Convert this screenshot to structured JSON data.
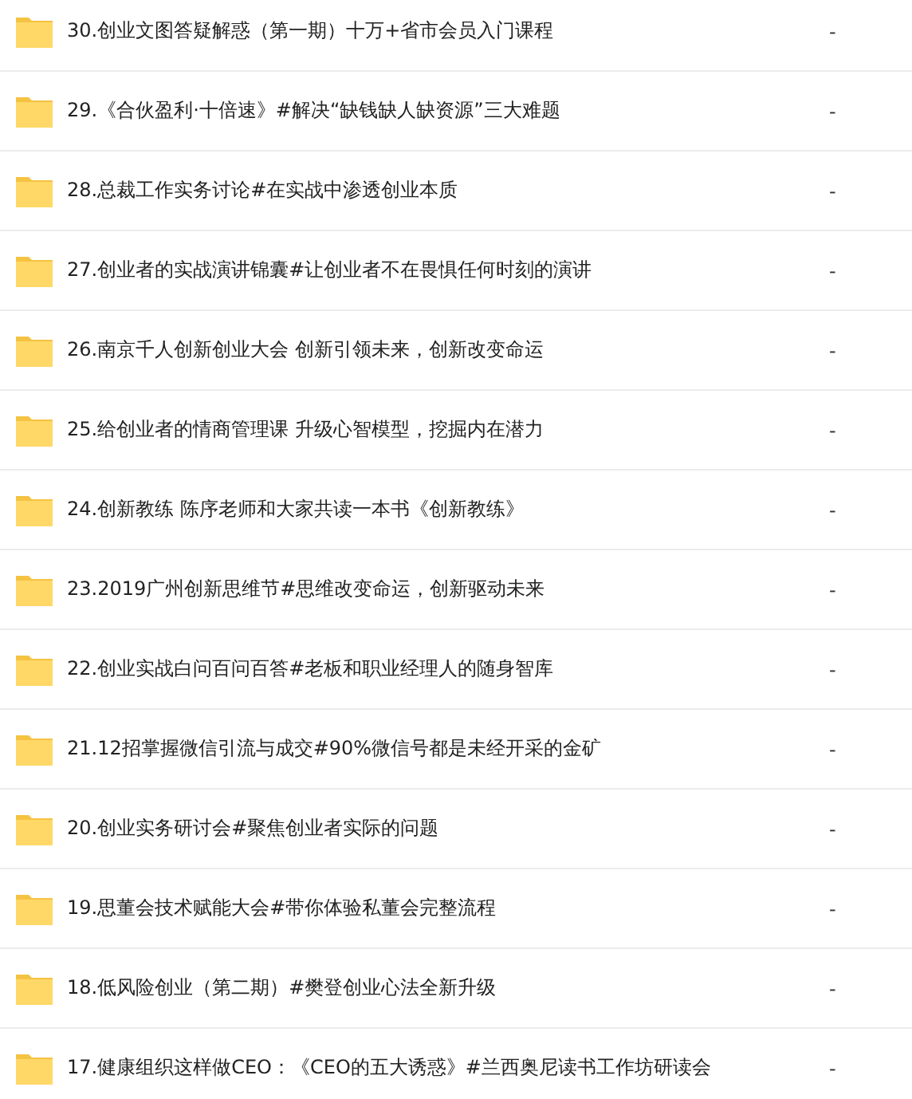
{
  "files": [
    {
      "name": "30.创业文图答疑解惑（第一期）十万+省市会员入门课程",
      "size": "-"
    },
    {
      "name": "29.《合伙盈利·十倍速》#解决“缺钱缺人缺资源”三大难题",
      "size": "-"
    },
    {
      "name": "28.总裁工作实务讨论#在实战中渗透创业本质",
      "size": "-"
    },
    {
      "name": "27.创业者的实战演讲锦囊#让创业者不在畏惧任何时刻的演讲",
      "size": "-"
    },
    {
      "name": "26.南京千人创新创业大会 创新引领未来，创新改变命运",
      "size": "-"
    },
    {
      "name": "25.给创业者的情商管理课 升级心智模型，挖掘内在潜力",
      "size": "-"
    },
    {
      "name": "24.创新教练 陈序老师和大家共读一本书《创新教练》",
      "size": "-"
    },
    {
      "name": "23.2019广州创新思维节#思维改变命运，创新驱动未来",
      "size": "-"
    },
    {
      "name": "22.创业实战白问百问百答#老板和职业经理人的随身智库",
      "size": "-"
    },
    {
      "name": "21.12招掌握微信引流与成交#90%微信号都是未经开采的金矿",
      "size": "-"
    },
    {
      "name": "20.创业实务研讨会#聚焦创业者实际的问题",
      "size": "-"
    },
    {
      "name": "19.思董会技术赋能大会#带你体验私董会完整流程",
      "size": "-"
    },
    {
      "name": "18.低风险创业（第二期）#樊登创业心法全新升级",
      "size": "-"
    },
    {
      "name": "17.健康组织这样做CEO：《CEO的五大诱惑》#兰西奥尼读书工作坊研读会",
      "size": "-"
    }
  ]
}
